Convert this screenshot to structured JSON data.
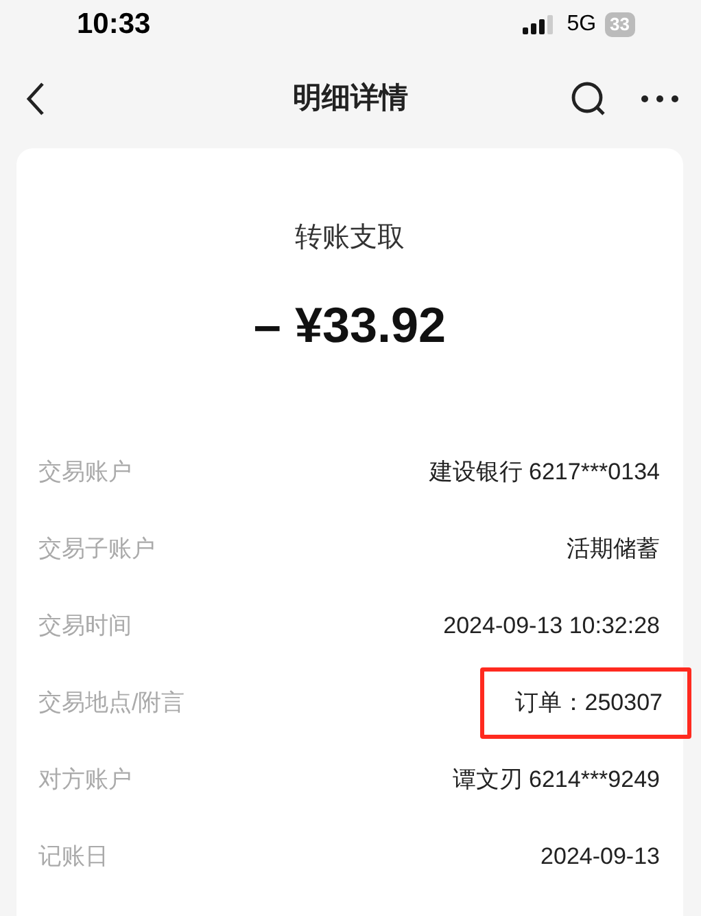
{
  "status_bar": {
    "time": "10:33",
    "network": "5G",
    "battery": "33"
  },
  "header": {
    "title": "明细详情"
  },
  "summary": {
    "type": "转账支取",
    "amount": "– ¥33.92"
  },
  "rows": [
    {
      "label": "交易账户",
      "value": "建设银行 6217***0134",
      "highlighted": false
    },
    {
      "label": "交易子账户",
      "value": "活期储蓄",
      "highlighted": false
    },
    {
      "label": "交易时间",
      "value": "2024-09-13 10:32:28",
      "highlighted": false
    },
    {
      "label": "交易地点/附言",
      "value": "订单：250307",
      "highlighted": true
    },
    {
      "label": "对方账户",
      "value": "谭文刃 6214***9249",
      "highlighted": false
    },
    {
      "label": "记账日",
      "value": "2024-09-13",
      "highlighted": false
    }
  ]
}
